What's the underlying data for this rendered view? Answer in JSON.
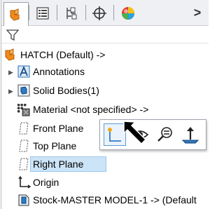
{
  "tabs": [
    {
      "name": "featuremanager-tab",
      "icon": "featuremanager-icon",
      "active": true
    },
    {
      "name": "propertymanager-tab",
      "icon": "propertymanager-icon",
      "active": false
    },
    {
      "name": "configurationmanager-tab",
      "icon": "configurationmanager-icon",
      "active": false
    },
    {
      "name": "dimxpertmanager-tab",
      "icon": "dimxpert-icon",
      "active": false
    },
    {
      "name": "displaymanager-tab",
      "icon": "displaymanager-icon",
      "active": false
    }
  ],
  "tab_overflow": ">",
  "tree": {
    "root_label": "HATCH  (Default) ->",
    "items": [
      {
        "label": "Annotations",
        "icon": "annotations-icon"
      },
      {
        "label": "Solid Bodies(1)",
        "icon": "solid-bodies-icon"
      },
      {
        "label": "Material <not specified> ->",
        "icon": "material-icon"
      },
      {
        "label": "Front Plane",
        "icon": "plane-icon"
      },
      {
        "label": "Top Plane",
        "icon": "plane-icon"
      },
      {
        "label": "Right Plane",
        "icon": "plane-icon",
        "selected": true
      },
      {
        "label": "Origin",
        "icon": "origin-icon"
      },
      {
        "label": "Stock-MASTER MODEL-1 -> (Default",
        "icon": "derived-part-icon"
      }
    ]
  },
  "context_toolbar": [
    {
      "name": "sketch-button",
      "icon": "sketch-icon"
    },
    {
      "name": "show-hide-button",
      "icon": "eye-icon"
    },
    {
      "name": "zoom-to-selection-button",
      "icon": "zoom-to-selection-icon"
    },
    {
      "name": "normal-to-button",
      "icon": "normal-to-icon"
    }
  ],
  "colors": {
    "selection_bg": "#cce4f7",
    "selection_border": "#99c9ef",
    "accent_blue": "#2e7cc7",
    "orange": "#f08a1c"
  }
}
